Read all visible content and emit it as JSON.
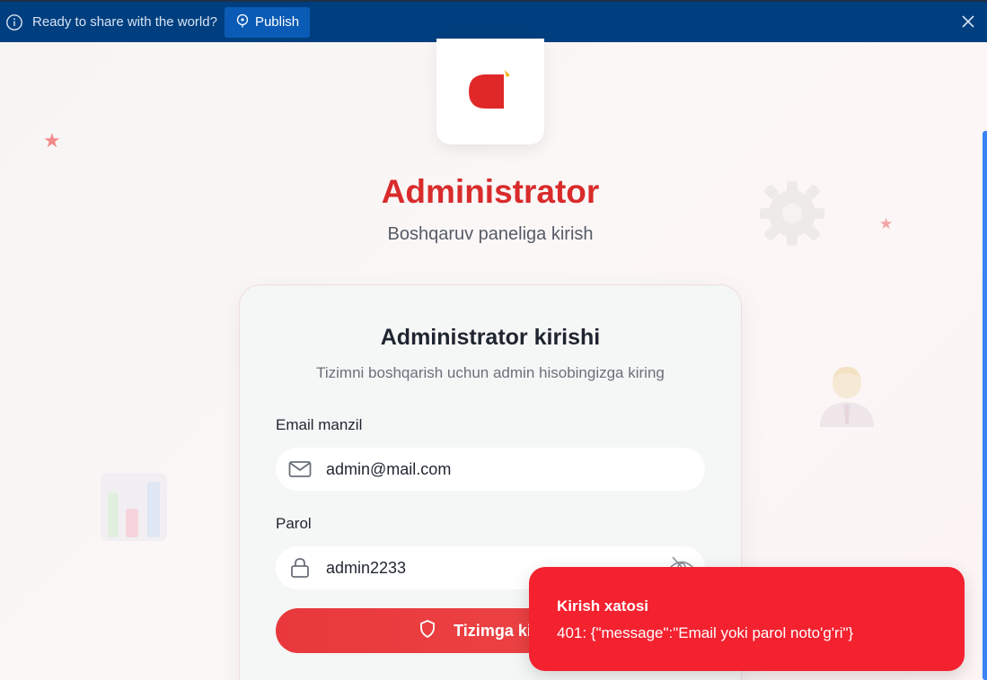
{
  "banner": {
    "text": "Ready to share with the world?",
    "publish_label": "Publish",
    "info_icon": "info-icon",
    "close_icon": "close-icon"
  },
  "brand": {
    "title": "Administrator",
    "subtitle": "Boshqaruv paneliga kirish",
    "accent": "#d92b2b"
  },
  "login_card": {
    "title": "Administrator kirishi",
    "description": "Tizimni boshqarish uchun admin hisobingizga kiring",
    "email": {
      "label": "Email manzil",
      "value": "admin@mail.com",
      "icon": "mail-icon"
    },
    "password": {
      "label": "Parol",
      "value": "admin2233",
      "icon": "lock-icon",
      "toggle_icon": "eye-off-icon"
    },
    "submit_label": "Tizimga kirish",
    "submit_icon": "shield-icon"
  },
  "toast": {
    "title": "Kirish xatosi",
    "message": "401: {\"message\":\"Email yoki parol noto'g'ri\"}",
    "color": "#f4212f"
  }
}
